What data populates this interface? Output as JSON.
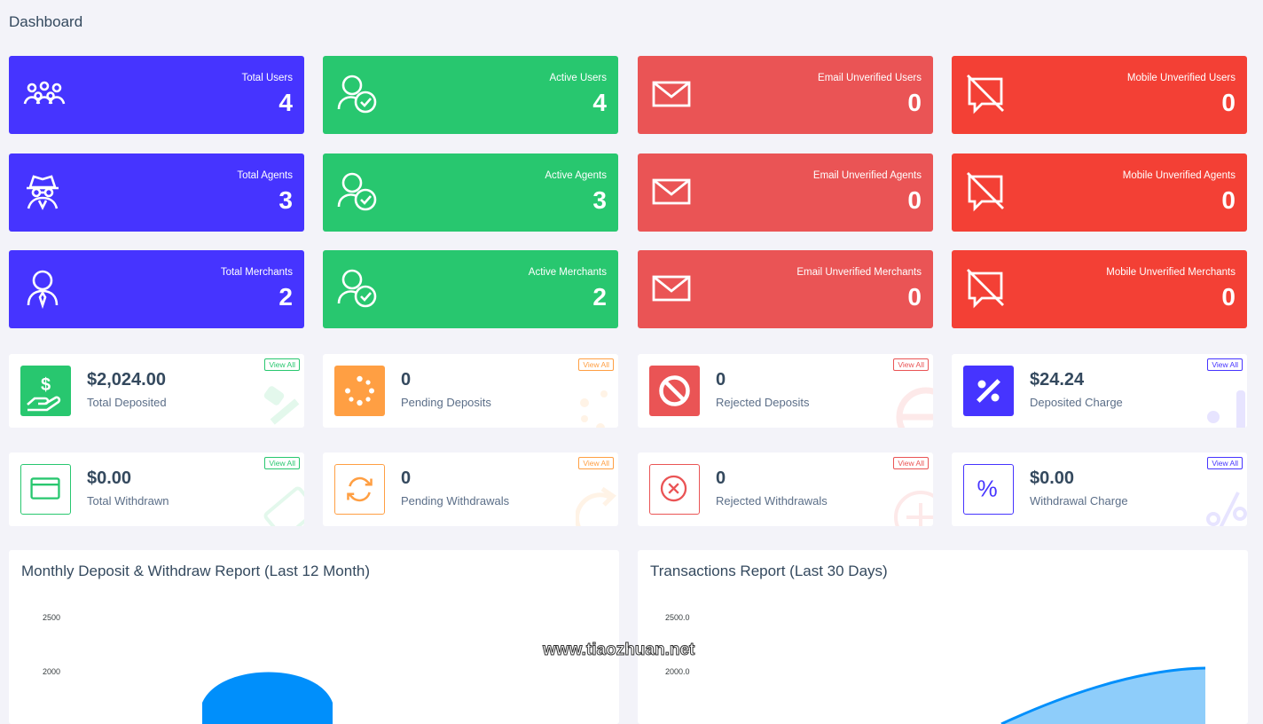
{
  "page": {
    "title": "Dashboard"
  },
  "stats": [
    {
      "label": "Total Users",
      "value": "4",
      "icon": "users-icon"
    },
    {
      "label": "Active Users",
      "value": "4",
      "icon": "user-check-icon"
    },
    {
      "label": "Email Unverified Users",
      "value": "0",
      "icon": "envelope-icon"
    },
    {
      "label": "Mobile Unverified Users",
      "value": "0",
      "icon": "comment-slash-icon"
    },
    {
      "label": "Total Agents",
      "value": "3",
      "icon": "user-secret-icon"
    },
    {
      "label": "Active Agents",
      "value": "3",
      "icon": "user-check-icon"
    },
    {
      "label": "Email Unverified Agents",
      "value": "0",
      "icon": "envelope-icon"
    },
    {
      "label": "Mobile Unverified Agents",
      "value": "0",
      "icon": "comment-slash-icon"
    },
    {
      "label": "Total Merchants",
      "value": "2",
      "icon": "user-tie-icon"
    },
    {
      "label": "Active Merchants",
      "value": "2",
      "icon": "user-check-icon"
    },
    {
      "label": "Email Unverified Merchants",
      "value": "0",
      "icon": "envelope-icon"
    },
    {
      "label": "Mobile Unverified Merchants",
      "value": "0",
      "icon": "comment-slash-icon"
    }
  ],
  "widgets": [
    {
      "value": "$2,024.00",
      "label": "Total Deposited",
      "view_all": "View All",
      "icon": "hand-holding-dollar-icon",
      "color": "#28c76f"
    },
    {
      "value": "0",
      "label": "Pending Deposits",
      "view_all": "View All",
      "icon": "spinner-icon",
      "color": "#ff9f43"
    },
    {
      "value": "0",
      "label": "Rejected Deposits",
      "view_all": "View All",
      "icon": "ban-icon",
      "color": "#ea5455"
    },
    {
      "value": "$24.24",
      "label": "Deposited Charge",
      "view_all": "View All",
      "icon": "percent-icon",
      "color": "#4634ff"
    },
    {
      "value": "$0.00",
      "label": "Total Withdrawn",
      "view_all": "View All",
      "icon": "credit-card-icon",
      "color": "#28c76f"
    },
    {
      "value": "0",
      "label": "Pending Withdrawals",
      "view_all": "View All",
      "icon": "sync-icon",
      "color": "#ff9f43"
    },
    {
      "value": "0",
      "label": "Rejected Withdrawals",
      "view_all": "View All",
      "icon": "times-circle-icon",
      "color": "#ea5455"
    },
    {
      "value": "$0.00",
      "label": "Withdrawal Charge",
      "view_all": "View All",
      "icon": "percent-icon",
      "color": "#4634ff"
    }
  ],
  "charts": {
    "monthly": {
      "title": "Monthly Deposit & Withdraw Report (Last 12 Month)",
      "ticks": [
        "2500",
        "2000"
      ]
    },
    "transactions": {
      "title": "Transactions Report (Last 30 Days)",
      "ticks": [
        "2500.0",
        "2000.0"
      ]
    }
  },
  "watermark": "www.tiaozhuan.net",
  "colors": {
    "blue": "#4634ff",
    "green": "#28c76f",
    "red": "#ea5455",
    "red_alt": "#f34035",
    "orange": "#ff9f43",
    "chart_blue": "#008ffb"
  }
}
